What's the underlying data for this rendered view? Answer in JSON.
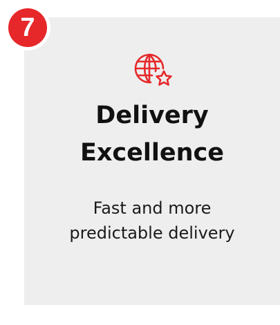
{
  "badge": {
    "number": "7"
  },
  "icon": {
    "name": "globe-star-icon",
    "color": "#e6282b"
  },
  "card": {
    "title_line1": "Delivery",
    "title_line2": "Excellence",
    "subtitle_line1": "Fast and more",
    "subtitle_line2": "predictable delivery",
    "background": "#eeeeee"
  },
  "colors": {
    "accent": "#e6282b",
    "text": "#111111"
  }
}
